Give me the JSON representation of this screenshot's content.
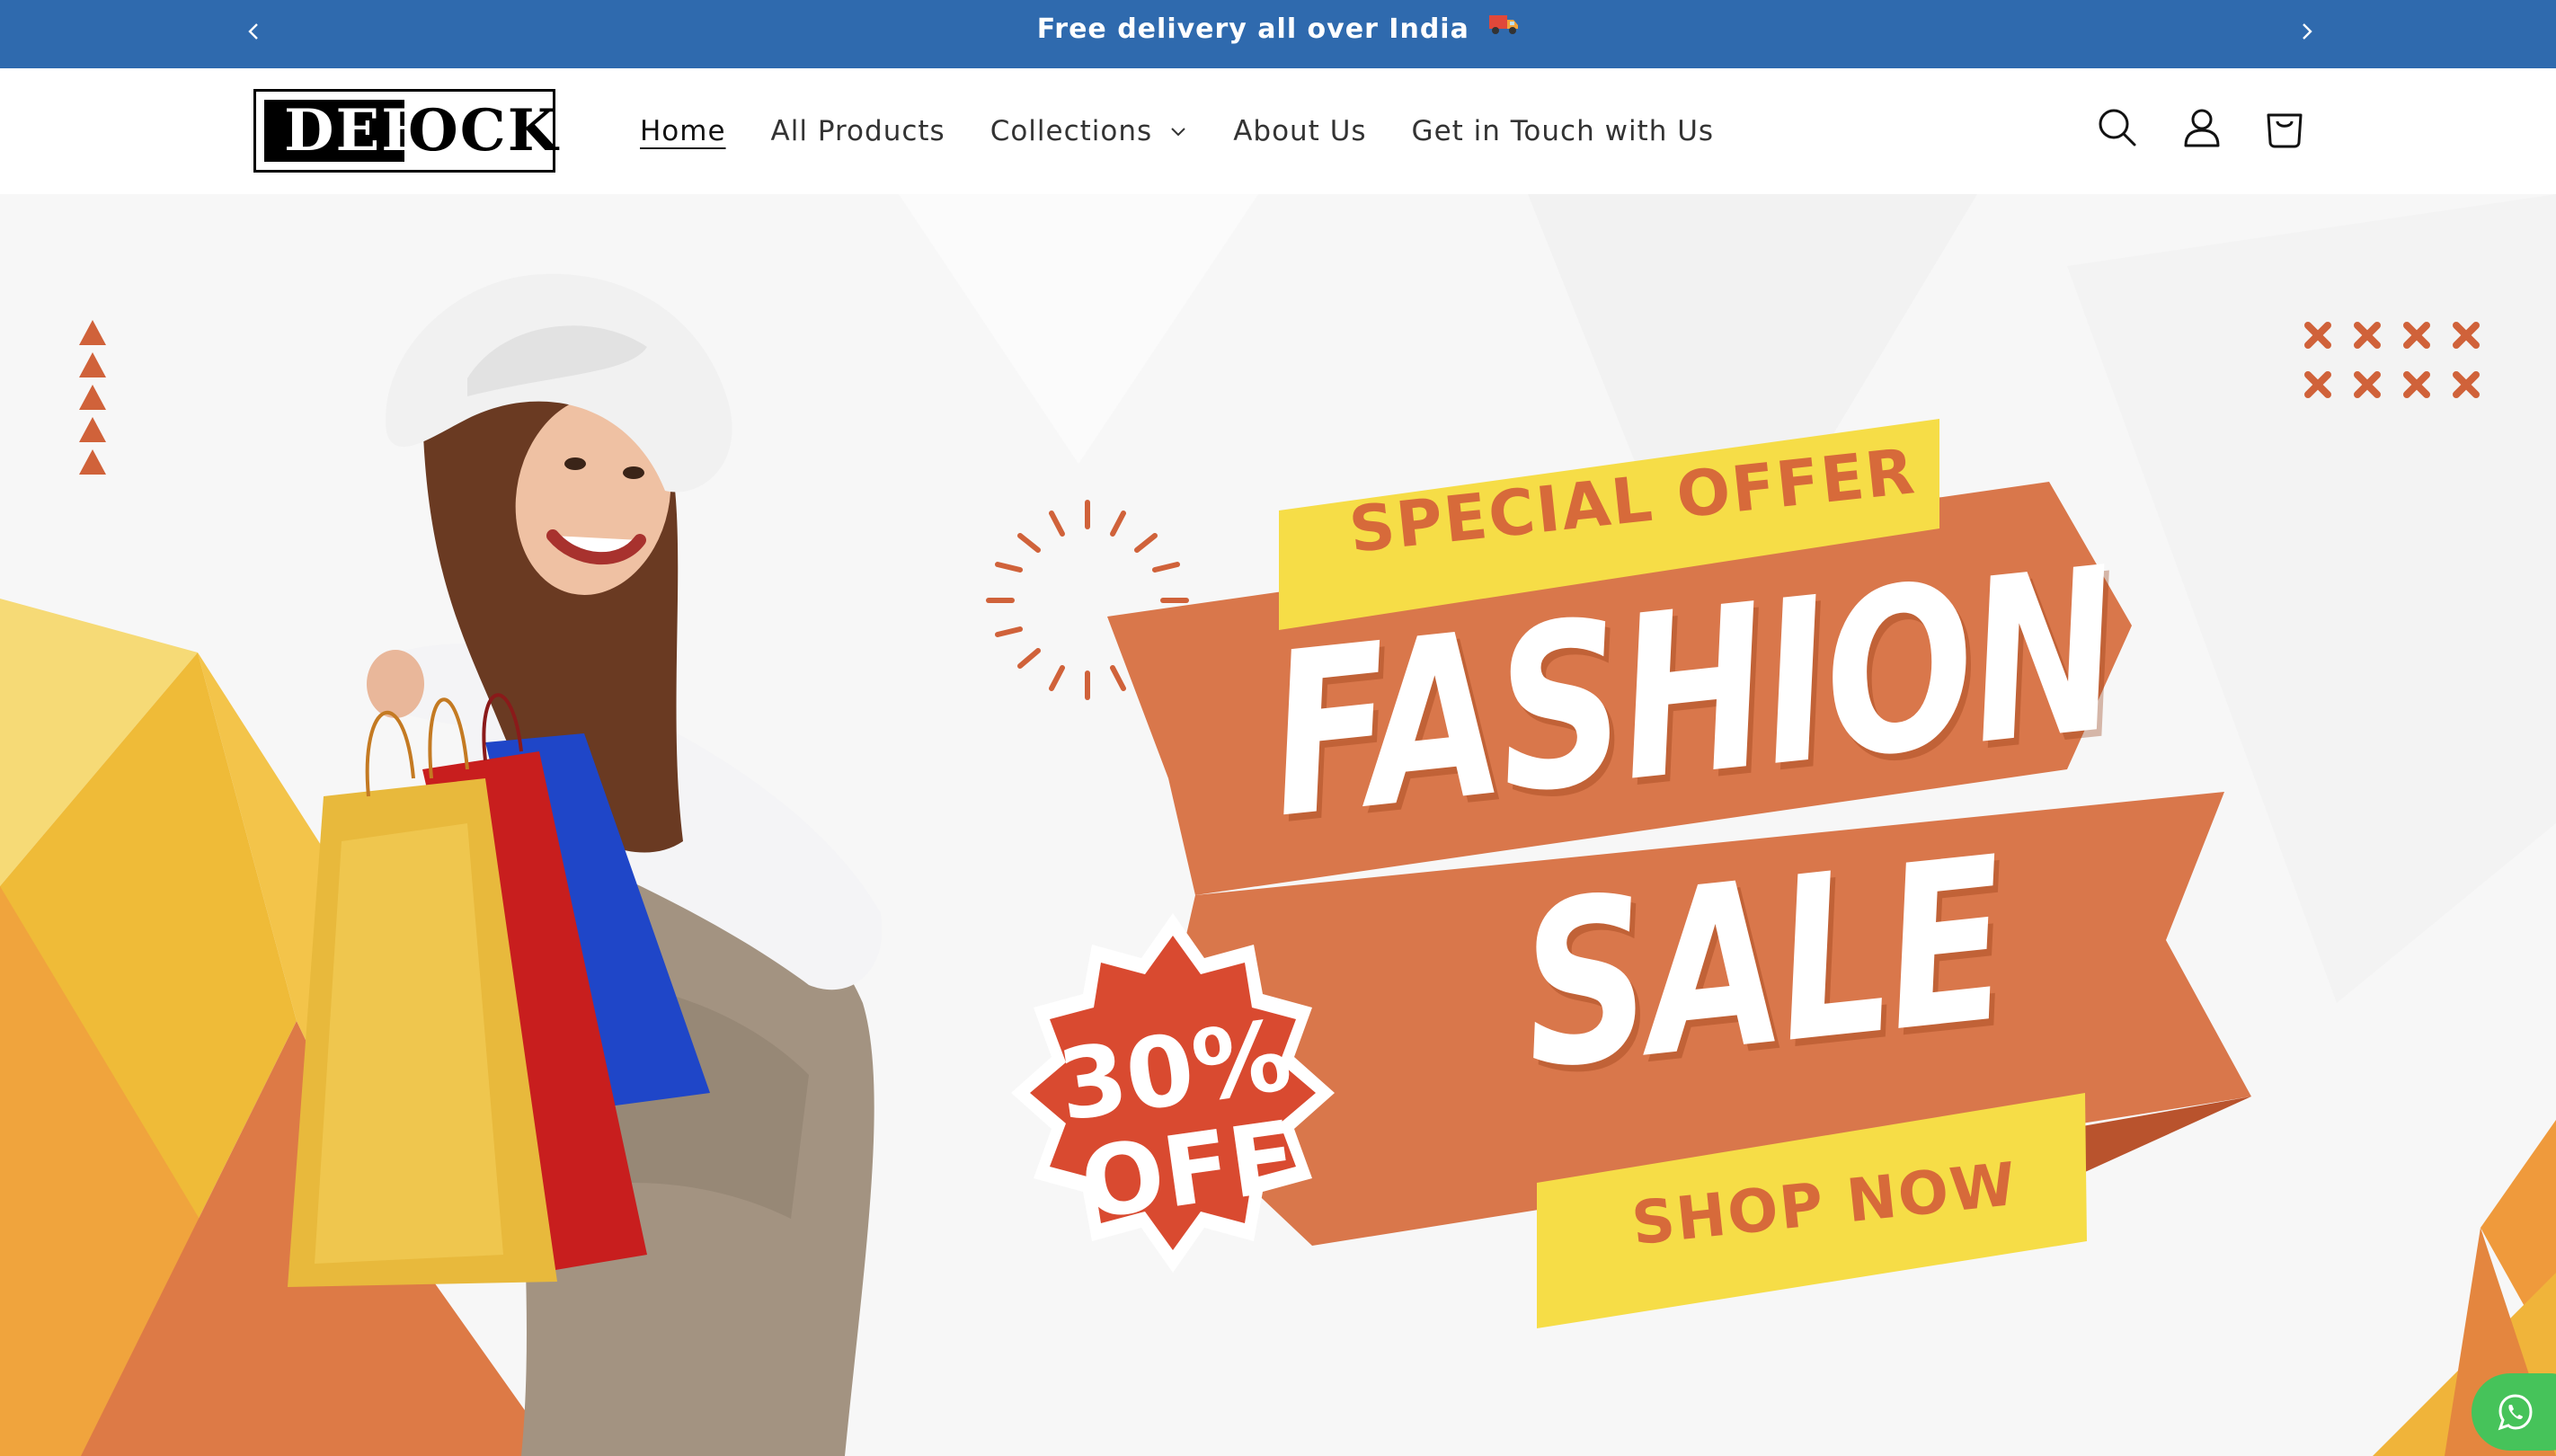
{
  "announcement": {
    "message": "Free delivery all over India",
    "emoji": "🚚",
    "prev_icon": "chevron-left-icon",
    "next_icon": "chevron-right-icon",
    "background": "#2f6aae"
  },
  "header": {
    "logo": {
      "part1": "DEB",
      "part2": "OCK"
    },
    "nav": [
      {
        "label": "Home",
        "active": true
      },
      {
        "label": "All Products"
      },
      {
        "label": "Collections",
        "has_dropdown": true
      },
      {
        "label": "About Us"
      },
      {
        "label": "Get in Touch with Us"
      }
    ],
    "icons": [
      "search-icon",
      "account-icon",
      "cart-icon"
    ]
  },
  "hero": {
    "special_offer": "SPECIAL OFFER",
    "headline_1": "FASHION",
    "headline_2": "SALE",
    "discount_line1": "30%",
    "discount_line2": "OFF",
    "cta": "SHOP NOW",
    "colors": {
      "accent_orange": "#d9774b",
      "accent_yellow": "#f6dd47",
      "badge_red": "#d94a30"
    }
  },
  "floating": {
    "whatsapp_icon": "whatsapp-icon",
    "color": "#46c35a"
  }
}
